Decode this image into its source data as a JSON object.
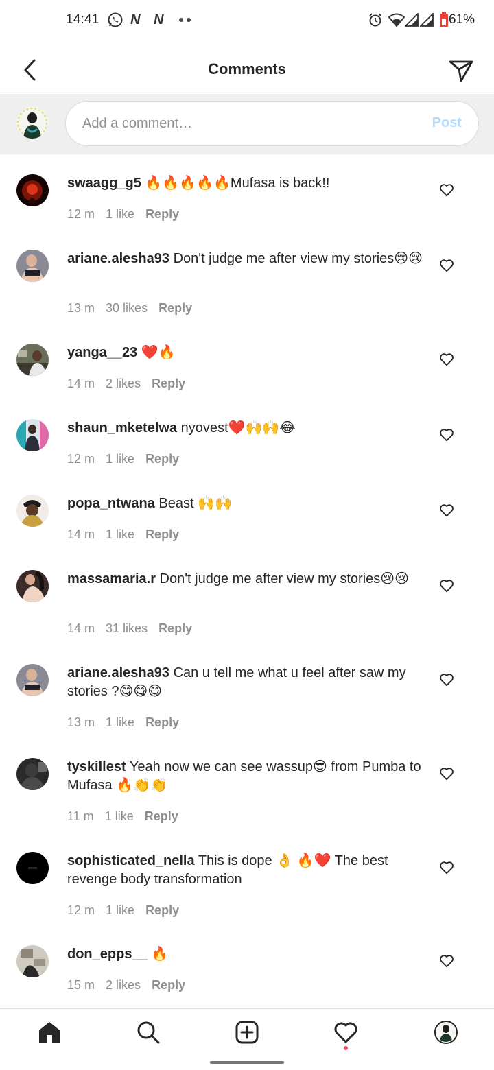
{
  "status_bar": {
    "time": "14:41",
    "notification_icons": [
      "whatsapp-icon",
      "n-icon",
      "n-icon",
      "more-dots-icon"
    ],
    "system_icons": [
      "alarm-icon",
      "wifi-icon",
      "signal-icon",
      "signal-icon",
      "battery-saver-icon"
    ],
    "battery_text": "61%"
  },
  "header": {
    "title": "Comments",
    "back_icon": "chevron-left-icon",
    "share_icon": "paper-plane-icon"
  },
  "composer": {
    "placeholder": "Add a comment…",
    "post_label": "Post"
  },
  "comments": [
    {
      "username": "swaagg_g5",
      "text": "🔥🔥🔥🔥🔥Mufasa is back!!",
      "time": "12 m",
      "likes": "1 like",
      "reply": "Reply"
    },
    {
      "username": "ariane.alesha93",
      "text": "Don't judge me after view my stories😢😢",
      "time": "13 m",
      "likes": "30 likes",
      "reply": "Reply"
    },
    {
      "username": "yanga__23",
      "text": "❤️🔥",
      "time": "14 m",
      "likes": "2 likes",
      "reply": "Reply"
    },
    {
      "username": "shaun_mketelwa",
      "text": "nyovest❤️🙌🙌😂",
      "time": "12 m",
      "likes": "1 like",
      "reply": "Reply"
    },
    {
      "username": "popa_ntwana",
      "text": "Beast 🙌🙌",
      "time": "14 m",
      "likes": "1 like",
      "reply": "Reply"
    },
    {
      "username": "massamaria.r",
      "text": "Don't judge me after view my stories😢😢",
      "time": "14 m",
      "likes": "31 likes",
      "reply": "Reply"
    },
    {
      "username": "ariane.alesha93",
      "text": "Can u tell me what u feel after saw my stories ?😋😋😋",
      "time": "13 m",
      "likes": "1 like",
      "reply": "Reply"
    },
    {
      "username": "tyskillest",
      "text": "Yeah now we can see wassup😎 from Pumba to Mufasa 🔥👏👏",
      "time": "11 m",
      "likes": "1 like",
      "reply": "Reply"
    },
    {
      "username": "sophisticated_nella",
      "text": "This is dope 👌 🔥❤️ The best revenge body transformation",
      "time": "12 m",
      "likes": "1 like",
      "reply": "Reply"
    },
    {
      "username": "don_epps__",
      "text": "🔥",
      "time": "15 m",
      "likes": "2 likes",
      "reply": "Reply"
    }
  ],
  "bottom_nav": {
    "items": [
      "home-icon",
      "search-icon",
      "new-post-icon",
      "activity-heart-icon",
      "profile-avatar"
    ],
    "activity_badge_color": "#ed4956"
  },
  "colors": {
    "post_button": "#b3dbff",
    "secondary_text": "#8e8e8e",
    "divider": "#dbdbdb"
  }
}
